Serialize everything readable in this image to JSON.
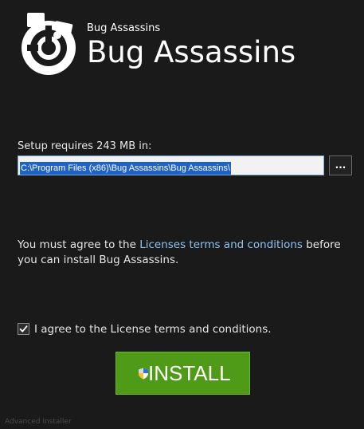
{
  "brand": {
    "small_title": "Bug Assassins",
    "big_title": "Bug Assassins",
    "logo_icon": "puzzle-piece-icon"
  },
  "install_location": {
    "label": "Setup requires 243 MB in:",
    "path": "C:\\Program Files (x86)\\Bug Assassins\\Bug Assassins\\",
    "browse_label": "..."
  },
  "license": {
    "text_before": "You must agree to the ",
    "link_text": "Licenses terms and conditions",
    "text_after": " before you can install Bug Assassins."
  },
  "agree": {
    "label": "I agree to the License terms and conditions.",
    "checked": true
  },
  "install": {
    "label": "INSTALL",
    "icon": "shield-icon"
  },
  "footer": {
    "text": "Advanced Installer"
  },
  "colors": {
    "background": "#1a1a1a",
    "install_green": "#4f9a16",
    "link_blue": "#8fc2f0",
    "selection_blue": "#1f63c6"
  }
}
